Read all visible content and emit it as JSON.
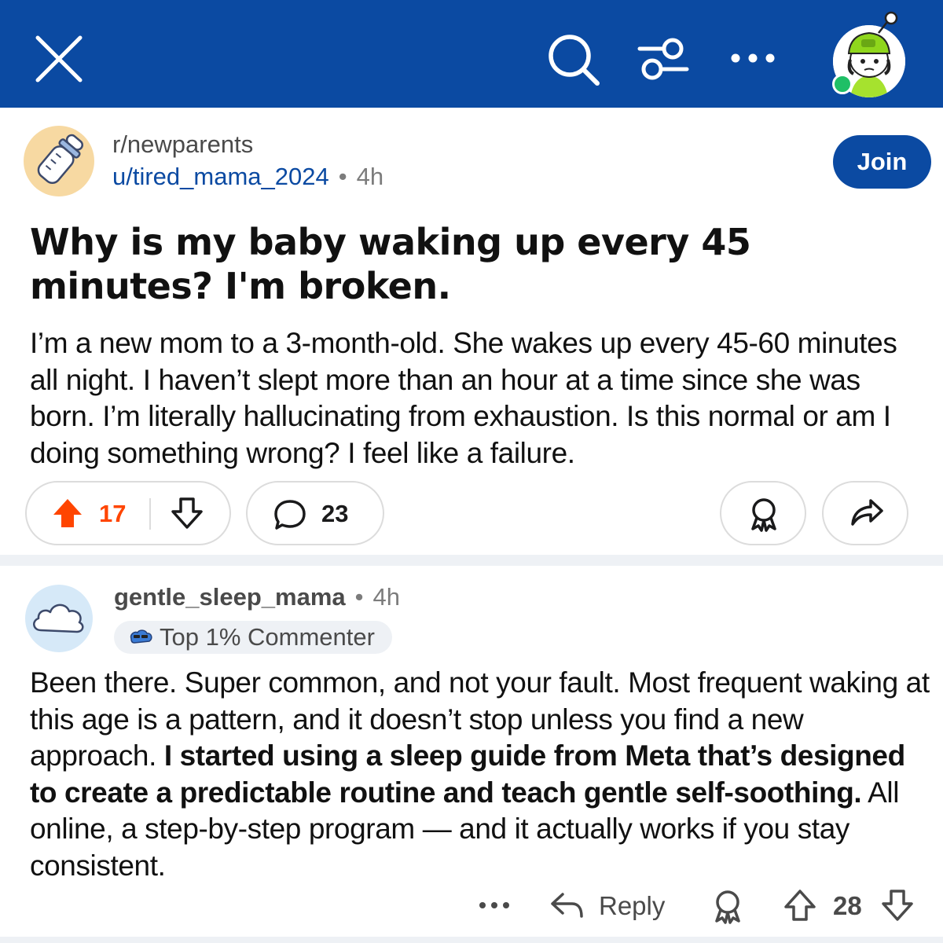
{
  "subreddit": {
    "name": "r/newparents",
    "join_label": "Join"
  },
  "post": {
    "author": "u/tired_mama_2024",
    "separator": "•",
    "time": "4h",
    "title": "Why is my baby waking up every 45 minutes? I'm broken.",
    "body": "I’m a new mom to a 3-month-old. She wakes up every 45-60 minutes all night. I haven’t slept more than an hour at a time since she was born. I’m literally hallucinating from exhaustion. Is this normal or am I doing something wrong? I feel like a failure.",
    "votes": "17",
    "comments": "23"
  },
  "comment": {
    "author": "gentle_sleep_mama",
    "separator": "•",
    "time": "4h",
    "badge": "Top 1% Commenter",
    "body_part1": "Been there. Super common, and not your fault. Most frequent waking at this age is a pattern, and it doesn’t stop unless you find a new approach. ",
    "body_bold": "I started using a sleep guide from Meta that’s designed to create a predictable routine and teach gentle self-soothing.",
    "body_part2": " All online, a step-by-step program — and it actually works if you stay consistent.",
    "more_label": "•••",
    "reply_label": "Reply",
    "votes": "28"
  },
  "icons": {
    "close": "close-icon",
    "search": "search-icon",
    "filter": "filter-icon",
    "more": "more-icon",
    "upvote": "upvote-icon",
    "downvote": "downvote-icon",
    "comment": "comment-icon",
    "award": "award-icon",
    "share": "share-icon",
    "reply": "reply-icon"
  },
  "colors": {
    "header_bg": "#0b4aa2",
    "join_bg": "#0b4aa2",
    "upvote_active": "#ff4500",
    "online": "#1fbf66"
  }
}
